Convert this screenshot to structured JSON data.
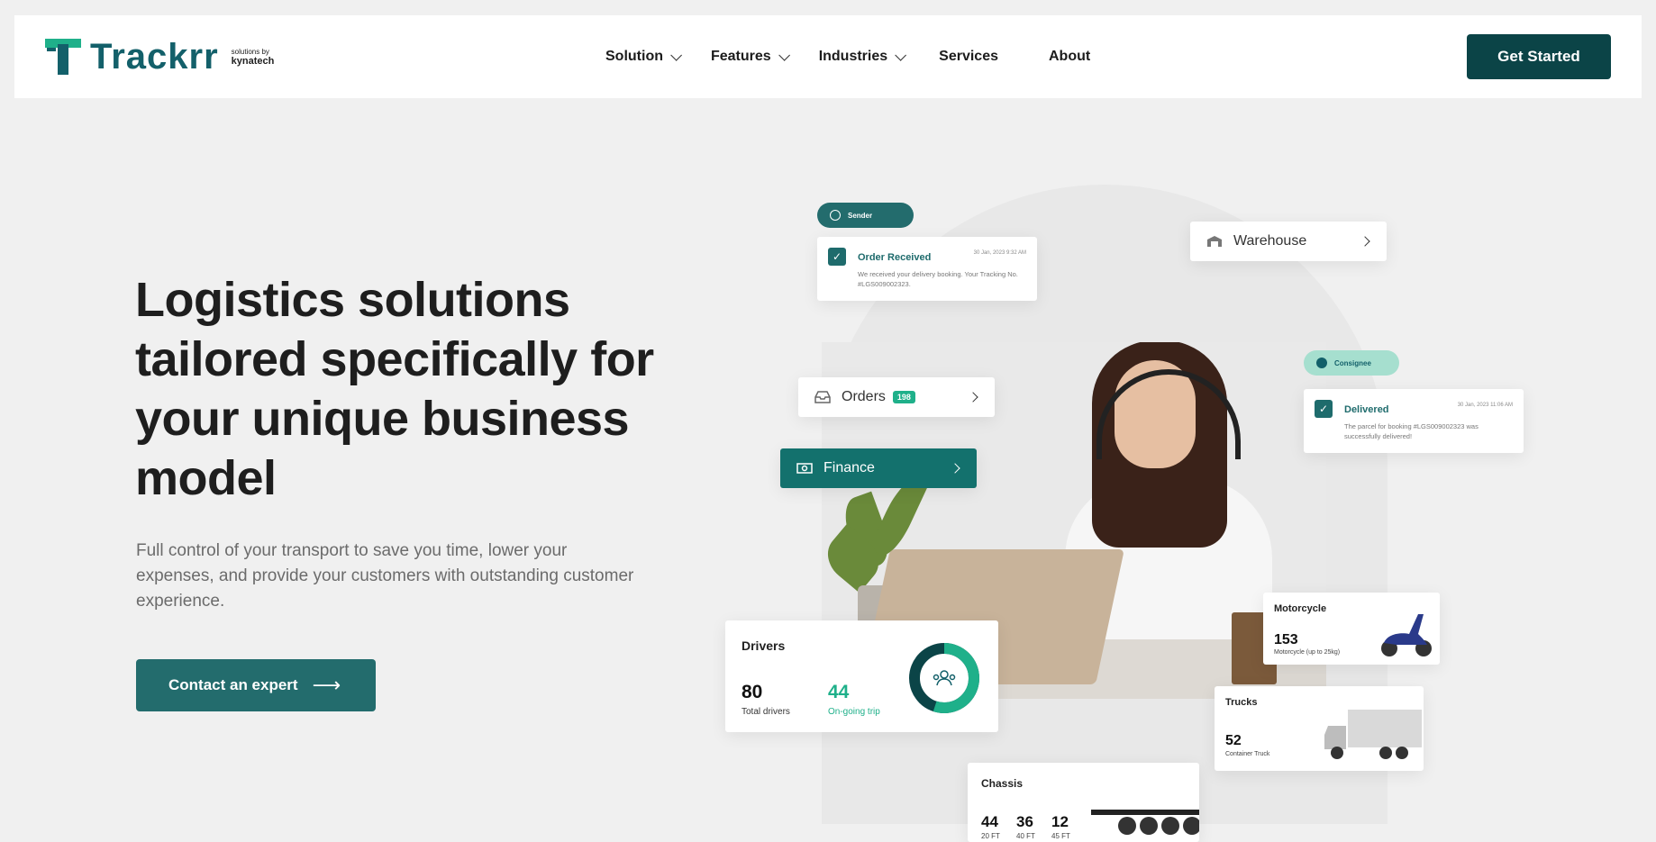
{
  "header": {
    "logo_text": "Trackrr",
    "logo_sub_top": "solutions by",
    "logo_sub_bottom": "kynatech",
    "nav": [
      {
        "label": "Solution"
      },
      {
        "label": "Features"
      },
      {
        "label": "Industries"
      },
      {
        "label": "Services"
      },
      {
        "label": "About"
      }
    ],
    "cta": "Get Started"
  },
  "hero": {
    "title": "Logistics solutions tailored specifically for your unique business model",
    "subtitle": "Full control of your transport to save you time, lower your expenses, and provide your customers with outstanding customer experience.",
    "button": "Contact an expert",
    "button_arrow": "⟶"
  },
  "illustration": {
    "sender_pill": "Sender",
    "order_received": {
      "title": "Order Received",
      "date": "30 Jan, 2023 9:32 AM",
      "message": "We received your delivery booking. Your Tracking No. #LGS009002323."
    },
    "warehouse": "Warehouse",
    "orders": {
      "label": "Orders",
      "count": "198"
    },
    "finance": "Finance",
    "consignee_pill": "Consignee",
    "delivered": {
      "title": "Delivered",
      "date": "30 Jan, 2023 11:06 AM",
      "message": "The parcel for booking #LGS009002323 was successfully delivered!"
    },
    "drivers": {
      "label": "Drivers",
      "total": "80",
      "total_label": "Total drivers",
      "ongoing": "44",
      "ongoing_label": "On-going trip",
      "ongoing_fraction": 0.55
    },
    "motorcycle": {
      "label": "Motorcycle",
      "value": "153",
      "sub": "Motorcycle (up to 25kg)"
    },
    "trucks": {
      "label": "Trucks",
      "value": "52",
      "sub": "Container Truck"
    },
    "chassis": {
      "label": "Chassis",
      "items": [
        {
          "value": "44",
          "size": "20 FT"
        },
        {
          "value": "36",
          "size": "40 FT"
        },
        {
          "value": "12",
          "size": "45 FT"
        }
      ]
    }
  },
  "colors": {
    "brand_dark": "#0b4447",
    "brand": "#236c6d",
    "accent_green": "#1fb08a",
    "pill_light": "#a6dfcf"
  }
}
